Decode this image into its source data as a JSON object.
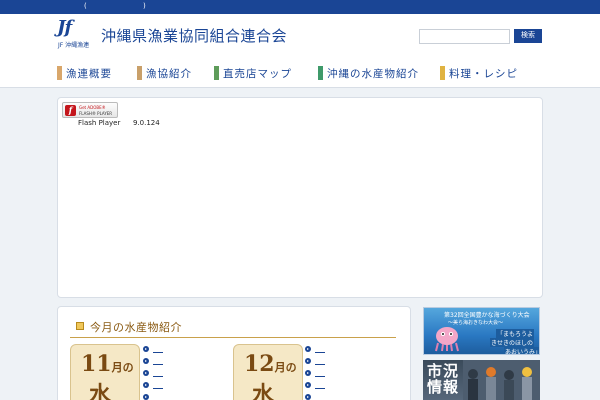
{
  "topbar": {
    "left_text": "(",
    "right_text": ")"
  },
  "header": {
    "logo_text": "Jf",
    "logo_sub": "JF 沖縄漁連",
    "title": "沖縄県漁業協同組合連合会",
    "search": {
      "placeholder": "",
      "button_label": "検索"
    }
  },
  "nav": {
    "items": [
      {
        "label": "漁連概要",
        "color": "#d9a76b"
      },
      {
        "label": "漁協紹介",
        "color": "#c9a06a"
      },
      {
        "label": "直売店マップ",
        "color": "#5e9c5a"
      },
      {
        "label": "沖縄の水産物紹介",
        "color": "#3f9a6a"
      },
      {
        "label": "料理・レシピ",
        "color": "#e0b341"
      }
    ]
  },
  "flash": {
    "badge_line1": "Get ADOBE®",
    "badge_line2": "FLASH® PLAYER",
    "label": "Flash Player",
    "version": "9.0.124"
  },
  "seafood": {
    "title": "今月の水産物紹介",
    "cards": [
      {
        "month_num": "11",
        "month_suffix": "月の",
        "kanji": "水"
      },
      {
        "month_num": "12",
        "month_suffix": "月の",
        "kanji": "水"
      }
    ]
  },
  "banners": {
    "b1_title": "第32回全国豊かな海づくり大会",
    "b1_sub": "〜美ら海おきなわ大会〜",
    "b1_a": "「まもろうよ",
    "b1_b": "きせきのほしの",
    "b1_c": "あおいうみ」",
    "b2_title": "市況情報"
  },
  "colors": {
    "brand": "#1a4595",
    "accent_gold": "#8a5a12"
  }
}
